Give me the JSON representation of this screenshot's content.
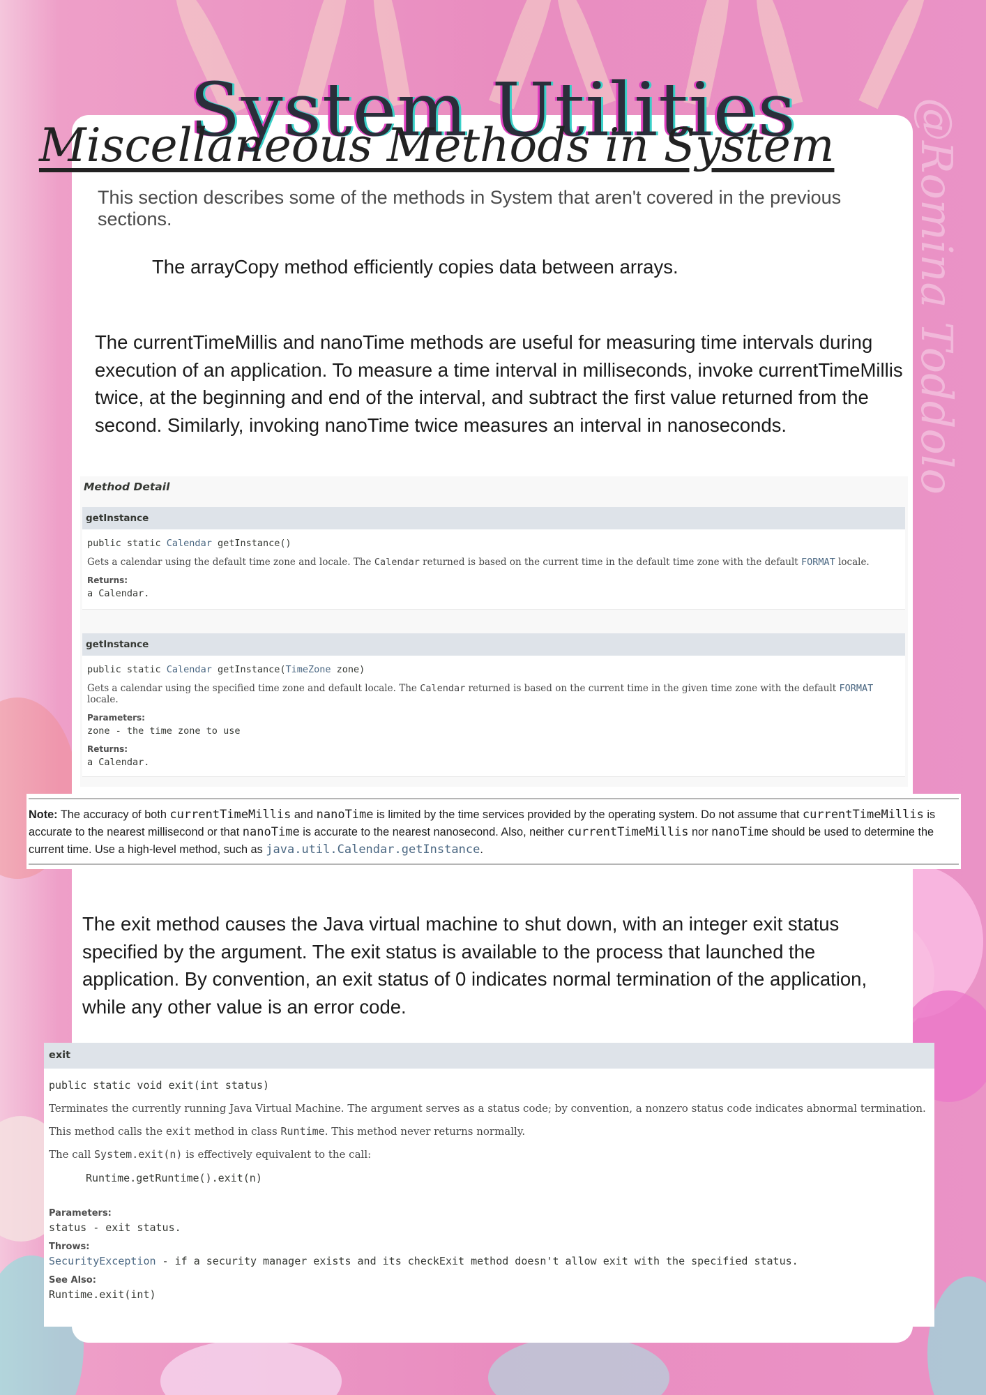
{
  "page": {
    "title": "System Utilities",
    "watermark": "@Romina Toddolo",
    "heading": "Miscellaneous Methods in System",
    "intro": "This section describes some of the methods in System that aren't covered in the previous sections.",
    "paragraphs": {
      "arraycopy": "The arrayCopy method efficiently copies data between arrays.",
      "timing": "The currentTimeMillis and nanoTime methods are useful for measuring time intervals during execution of an application. To measure a time interval in milliseconds, invoke currentTimeMillis twice, at the beginning and end of the interval, and subtract the first value returned from the second. Similarly, invoking nanoTime twice measures an interval in nanoseconds.",
      "exit": "The exit method causes the Java virtual machine to shut down, with an integer exit status specified by the argument. The exit status is available to the process that launched the application. By convention, an exit status of 0 indicates normal termination of the application, while any other value is an error code."
    }
  },
  "method_detail": {
    "heading": "Method Detail",
    "m1": {
      "name": "getInstance",
      "sig_prefix": "public static ",
      "sig_type": "Calendar",
      "sig_rest": " getInstance()",
      "desc_a": "Gets a calendar using the default time zone and locale. The ",
      "desc_code": "Calendar",
      "desc_b": " returned is based on the current time in the default time zone with the default ",
      "desc_link": "FORMAT",
      "desc_c": " locale.",
      "returns_label": "Returns:",
      "returns_value": "a Calendar."
    },
    "m2": {
      "name": "getInstance",
      "sig_prefix": "public static ",
      "sig_type": "Calendar",
      "sig_mid": " getInstance(",
      "sig_param_type": "TimeZone",
      "sig_end": " zone)",
      "desc_a": "Gets a calendar using the specified time zone and default locale. The ",
      "desc_code": "Calendar",
      "desc_b": " returned is based on the current time in the given time zone with the default ",
      "desc_link": "FORMAT",
      "desc_c": " locale.",
      "params_label": "Parameters:",
      "params_value": "zone - the time zone to use",
      "returns_label": "Returns:",
      "returns_value": "a Calendar."
    }
  },
  "note": {
    "label": "Note:",
    "t1": " The accuracy of both ",
    "c1": "currentTimeMillis",
    "t2": " and ",
    "c2": "nanoTime",
    "t3": " is limited by the time services provided by the operating system. Do not assume that ",
    "c3": "currentTimeMillis",
    "t4": " is accurate to the nearest millisecond or that ",
    "c4": "nanoTime",
    "t5": " is accurate to the nearest nanosecond. Also, neither ",
    "c5": "currentTimeMillis",
    "t6": " nor ",
    "c6": "nanoTime",
    "t7": " should be used to determine the current time. Use a high-level method, such as ",
    "link": "java.util.Calendar.getInstance",
    "t8": "."
  },
  "exit_doc": {
    "name": "exit",
    "signature": "public static void exit(int status)",
    "desc1": "Terminates the currently running Java Virtual Machine. The argument serves as a status code; by convention, a nonzero status code indicates abnormal termination.",
    "desc2_a": "This method calls the ",
    "desc2_code1": "exit",
    "desc2_b": " method in class ",
    "desc2_code2": "Runtime",
    "desc2_c": ". This method never returns normally.",
    "desc3_a": "The call ",
    "desc3_code": "System.exit(n)",
    "desc3_b": " is effectively equivalent to the call:",
    "code": "Runtime.getRuntime().exit(n)",
    "params_label": "Parameters:",
    "params_value": "status - exit status.",
    "throws_label": "Throws:",
    "throws_link": "SecurityException",
    "throws_rest": " - if a security manager exists and its checkExit method doesn't allow exit with the specified status.",
    "see_also_label": "See Also:",
    "see_also_link": "Runtime.exit(int)"
  },
  "colors": {
    "background_pink": "#e98dc0",
    "link_blue": "#4a6782",
    "javadoc_header": "#dee3e9",
    "title_shadow_magenta": "#e040c0",
    "title_shadow_cyan": "#3ad0c8"
  }
}
